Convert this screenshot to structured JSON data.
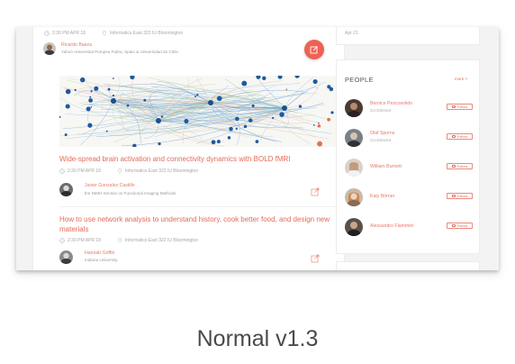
{
  "feed": {
    "top_event": {
      "time": "2:30 PM  APR 18",
      "location": "Informatics East 322  IU Bloomington",
      "speaker_name": "Ricardo Baeza",
      "speaker_affiliation": "Yahoo Universitat Pompeu Fabra, Spain & Universidad de Chile"
    },
    "events": [
      {
        "title": "Wide-spread brain activation and connectivity dynamics with BOLD fMRI",
        "time": "2:30 PM  APR 18",
        "location": "Informatics East 322  IU Bloomington",
        "speaker_name": "Javier Gonzalez Castillo",
        "speaker_affiliation": "the NIMH Section on Functional Imaging Methods"
      },
      {
        "title": "How to use network analysis to understand history, cook better food, and design new materials",
        "time": "2:30 PM  APR 18",
        "location": "Informatics East 322  IU Bloomington",
        "speaker_name": "Hannah Griffin",
        "speaker_affiliation": "Indiana University"
      }
    ]
  },
  "sidebar": {
    "top_card_date": "Apr 21",
    "people": {
      "heading": "PEOPLE",
      "more_label": "more >",
      "follow_label": "Follow",
      "list": [
        {
          "name": "Bernice Pescosolido",
          "role": "Co-Director"
        },
        {
          "name": "Olaf Sporns",
          "role": "Co-Director"
        },
        {
          "name": "William Burnett",
          "role": ""
        },
        {
          "name": "Katy Börner",
          "role": ""
        },
        {
          "name": "Alessandro Flammini",
          "role": ""
        }
      ]
    }
  },
  "caption": "Normal v1.3",
  "colors": {
    "accent": "#e46a58",
    "fab": "#ee6253",
    "muted": "#a7a7a7"
  }
}
